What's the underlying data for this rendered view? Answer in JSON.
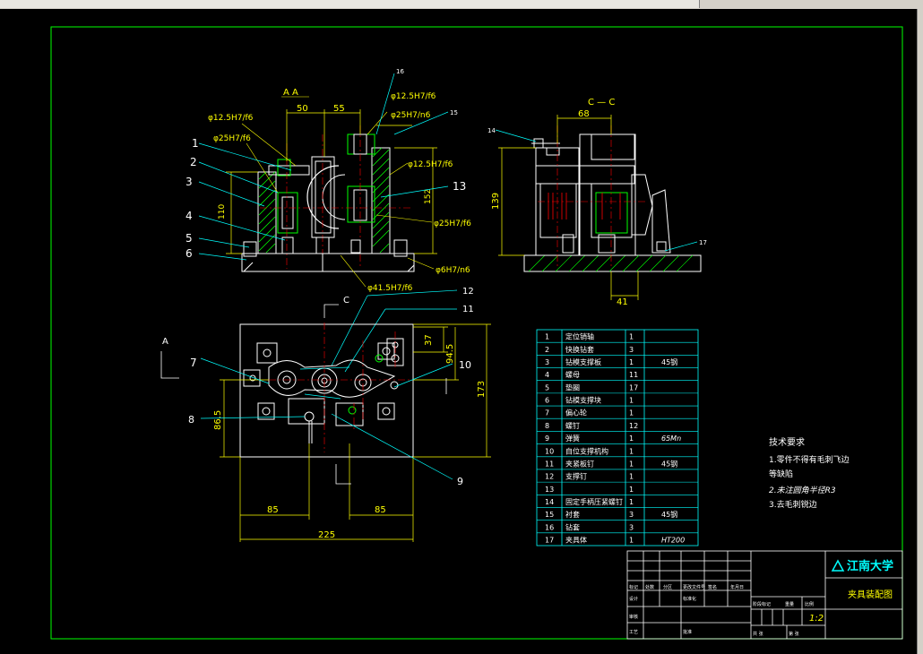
{
  "window": {
    "toolbar_segments": [
      "",
      "",
      "",
      "",
      "",
      ""
    ]
  },
  "drawing": {
    "views": {
      "section_aa": "A  A",
      "section_cc": "C — C",
      "plan_marker_a": "A",
      "plan_marker_c": "C"
    },
    "dims_front": {
      "d50": "50",
      "d55": "55",
      "d110": "110",
      "d152": "152",
      "fit_12_5_top": "φ12.5H7/f6",
      "fit_25_top": "φ25H7/n6",
      "fit_12_5_left": "φ12.5H7/f6",
      "fit_25_left": "φ25H7/f6",
      "fit_12_5_right": "φ12.5H7/f6",
      "fit_25_right": "φ25H7/f6",
      "fit_41_5": "φ41.5H7/f6",
      "fit_6": "φ6H7/n6"
    },
    "dims_side": {
      "d68": "68",
      "d139": "139",
      "d41": "41"
    },
    "dims_plan": {
      "d37": "37",
      "d94_5": "94.5",
      "d173": "173",
      "d86_5": "86.5",
      "d85_left": "85",
      "d85_right": "85",
      "d225": "225"
    },
    "balloons": {
      "b1": "1",
      "b2": "2",
      "b3": "3",
      "b4": "4",
      "b5": "5",
      "b6": "6",
      "b7": "7",
      "b8": "8",
      "b9": "9",
      "b10": "10",
      "b11": "11",
      "b12": "12",
      "b13": "13",
      "b14": "14",
      "b15": "15",
      "b16": "16",
      "b17": "17"
    }
  },
  "parts_list": {
    "rows": [
      {
        "no": "1",
        "name": "定位销轴",
        "qty": "1",
        "mat": ""
      },
      {
        "no": "2",
        "name": "快换钻套",
        "qty": "3",
        "mat": ""
      },
      {
        "no": "3",
        "name": "钻模支撑板",
        "qty": "1",
        "mat": "45钢"
      },
      {
        "no": "4",
        "name": "螺母",
        "qty": "11",
        "mat": ""
      },
      {
        "no": "5",
        "name": "垫圈",
        "qty": "17",
        "mat": ""
      },
      {
        "no": "6",
        "name": "钻模支撑块",
        "qty": "1",
        "mat": ""
      },
      {
        "no": "7",
        "name": "偏心轮",
        "qty": "1",
        "mat": ""
      },
      {
        "no": "8",
        "name": "螺钉",
        "qty": "12",
        "mat": ""
      },
      {
        "no": "9",
        "name": "弹簧",
        "qty": "1",
        "mat": "65Mn"
      },
      {
        "no": "10",
        "name": "自位支撑机构",
        "qty": "1",
        "mat": ""
      },
      {
        "no": "11",
        "name": "夹紧板钉",
        "qty": "1",
        "mat": "45钢"
      },
      {
        "no": "12",
        "name": "支撑钉",
        "qty": "1",
        "mat": ""
      },
      {
        "no": "13",
        "name": "",
        "qty": "1",
        "mat": ""
      },
      {
        "no": "14",
        "name": "固定手柄压紧螺钉",
        "qty": "1",
        "mat": ""
      },
      {
        "no": "15",
        "name": "衬套",
        "qty": "3",
        "mat": "45钢"
      },
      {
        "no": "16",
        "name": "钻套",
        "qty": "3",
        "mat": ""
      },
      {
        "no": "17",
        "name": "夹具体",
        "qty": "1",
        "mat": "HT200"
      }
    ]
  },
  "tech_requirements": {
    "title": "技术要求",
    "line1": "1.零件不得有毛刺飞边",
    "line2": "等缺陷",
    "line3": "2.未注圆角半径R3",
    "line4": "3.去毛刺锐边"
  },
  "title_block": {
    "university": "江南大学",
    "drawing_name": "夹具装配图",
    "scale": "1:2",
    "labels": {
      "mark": "标记",
      "count": "处数",
      "zone": "分区",
      "change_no": "更改文件号",
      "sign": "签名",
      "date": "年月日",
      "design": "设计",
      "design_std": "标准化",
      "check": "审核",
      "craft": "工艺",
      "approve": "批准",
      "stage_mark": "阶段标记",
      "weight": "重量",
      "ratio": "比例",
      "sheet_total": "共 张",
      "sheet_no": "第 张"
    }
  },
  "colors": {
    "background": "#000000",
    "frame": "#00ff00",
    "part_outline": "#ffffff",
    "dimension": "#ffff00",
    "leader": "#00ffff",
    "section_hatch": "#00ff00",
    "center_line": "#ff0000",
    "title_block_line": "#ffffff"
  }
}
